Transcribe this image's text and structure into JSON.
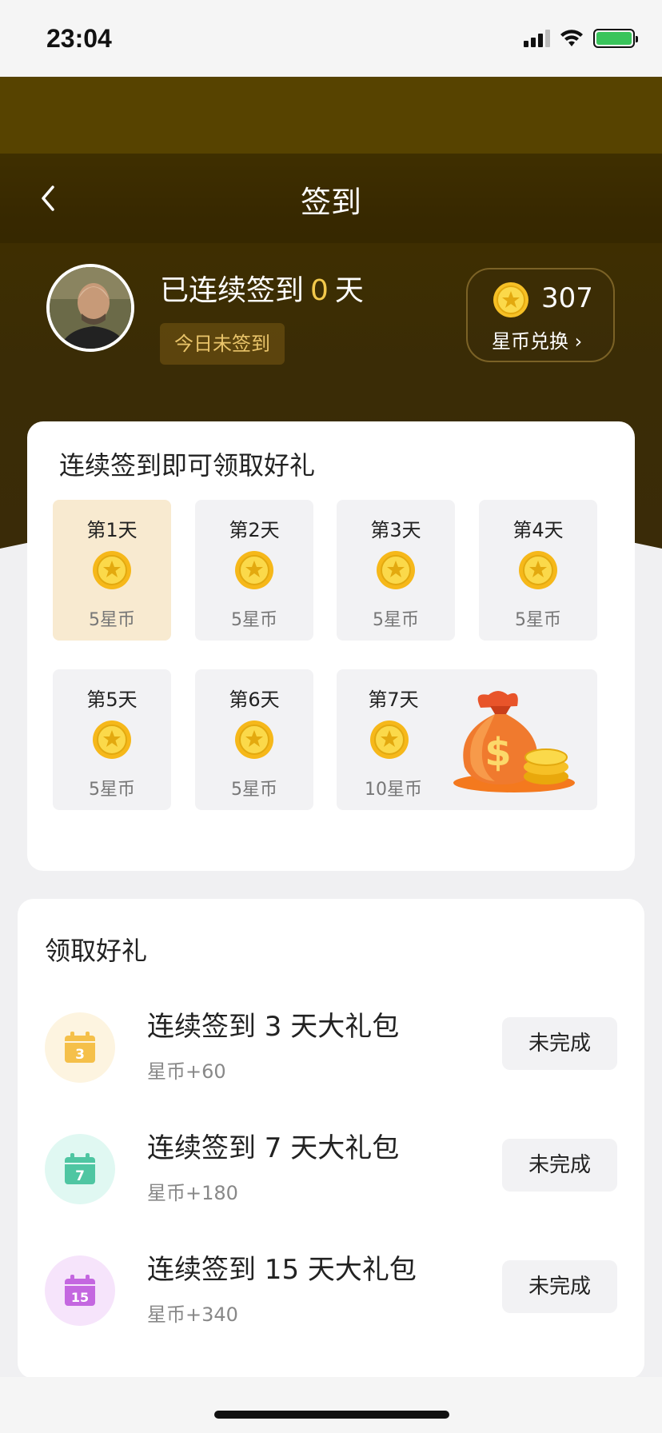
{
  "status_bar": {
    "time": "23:04"
  },
  "header": {
    "title": "签到",
    "streak_prefix": "已连续签到",
    "streak_days": "0",
    "streak_suffix": "天",
    "today_status": "今日未签到",
    "coin_balance": "307",
    "exchange_label": "星币兑换 ›"
  },
  "signin_card": {
    "title": "连续签到即可领取好礼",
    "days": [
      {
        "label": "第1天",
        "reward": "5星币",
        "active": true
      },
      {
        "label": "第2天",
        "reward": "5星币"
      },
      {
        "label": "第3天",
        "reward": "5星币"
      },
      {
        "label": "第4天",
        "reward": "5星币"
      },
      {
        "label": "第5天",
        "reward": "5星币"
      },
      {
        "label": "第6天",
        "reward": "5星币"
      },
      {
        "label": "第7天",
        "reward": "10星币"
      }
    ]
  },
  "gifts_card": {
    "title": "领取好礼",
    "items": [
      {
        "name": "连续签到 3 天大礼包",
        "reward": "星币+60",
        "button": "未完成",
        "icon_day": "3",
        "icon": "calendar-icon",
        "icon_color": "#f5c04a",
        "bg": "#fdf4e0"
      },
      {
        "name": "连续签到 7 天大礼包",
        "reward": "星币+180",
        "button": "未完成",
        "icon_day": "7",
        "icon": "calendar-icon",
        "icon_color": "#4fc6a2",
        "bg": "#e0f8f2"
      },
      {
        "name": "连续签到 15 天大礼包",
        "reward": "星币+340",
        "button": "未完成",
        "icon_day": "15",
        "icon": "calendar-icon",
        "icon_color": "#c467e0",
        "bg": "#f6e4fb"
      }
    ]
  },
  "colors": {
    "accent_gold": "#f2c94c",
    "header_brown": "#3f2f00"
  }
}
